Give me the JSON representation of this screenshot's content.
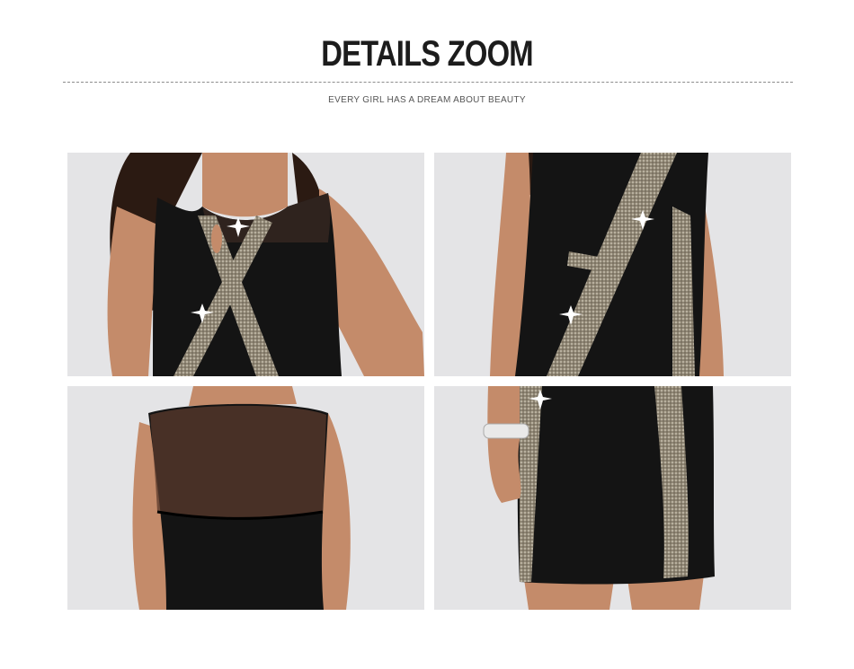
{
  "header": {
    "title": "DETAILS ZOOM",
    "subtitle": "EVERY GIRL HAS A DREAM ABOUT BEAUTY"
  },
  "colors": {
    "background": "#ffffff",
    "photo_background": "#e6e6e6",
    "dress": "#141414",
    "skin": "#c48b6a",
    "sequin": "#a39a86"
  },
  "gallery": {
    "photos": [
      {
        "subject": "dress-front-neckline-detail"
      },
      {
        "subject": "dress-side-waist-detail"
      },
      {
        "subject": "dress-back-mesh-detail"
      },
      {
        "subject": "dress-skirt-hem-detail"
      }
    ]
  }
}
